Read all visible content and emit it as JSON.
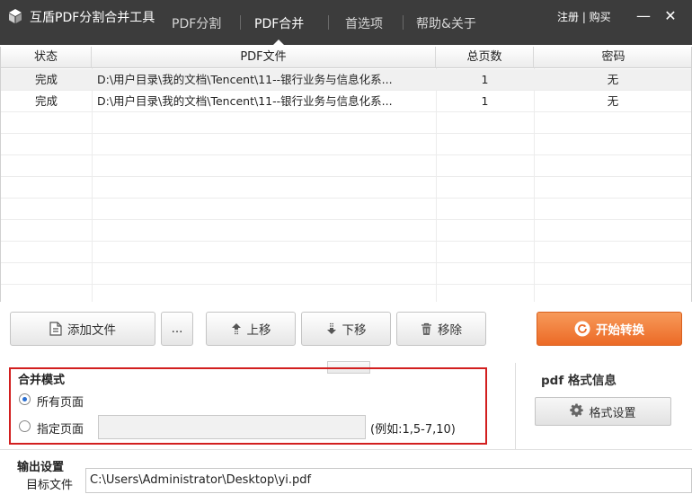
{
  "app": {
    "title": "互盾PDF分割合并工具",
    "register_buy": "注册 | 购买",
    "minimize_glyph": "—",
    "close_glyph": "✕"
  },
  "tabs": [
    {
      "label": "PDF分割",
      "active": false
    },
    {
      "label": "PDF合并",
      "active": true
    },
    {
      "label": "首选项",
      "active": false
    },
    {
      "label": "帮助&关于",
      "active": false
    }
  ],
  "table": {
    "columns": [
      "状态",
      "PDF文件",
      "总页数",
      "密码"
    ],
    "rows": [
      {
        "status": "完成",
        "file": "D:\\用户目录\\我的文档\\Tencent\\11--银行业务与信息化系...",
        "pages": "1",
        "password": "无"
      },
      {
        "status": "完成",
        "file": "D:\\用户目录\\我的文档\\Tencent\\11--银行业务与信息化系...",
        "pages": "1",
        "password": "无"
      }
    ]
  },
  "toolbar": {
    "add_file": "添加文件",
    "more": "...",
    "move_up": "上移",
    "move_down": "下移",
    "remove": "移除",
    "start": "开始转换"
  },
  "merge_mode": {
    "title": "合并模式",
    "option_all": "所有页面",
    "option_specified": "指定页面",
    "selected": "all",
    "page_range_value": "",
    "hint": "(例如:1,5-7,10)"
  },
  "pdf_format": {
    "title": "pdf 格式信息",
    "button": "格式设置"
  },
  "output": {
    "title": "输出设置",
    "target_label": "目标文件",
    "target_value": "C:\\Users\\Administrator\\Desktop\\yi.pdf"
  },
  "colors": {
    "titlebar": "#3c3c3c",
    "accent": "#ec6a26",
    "highlight_border": "#d21f1f"
  }
}
